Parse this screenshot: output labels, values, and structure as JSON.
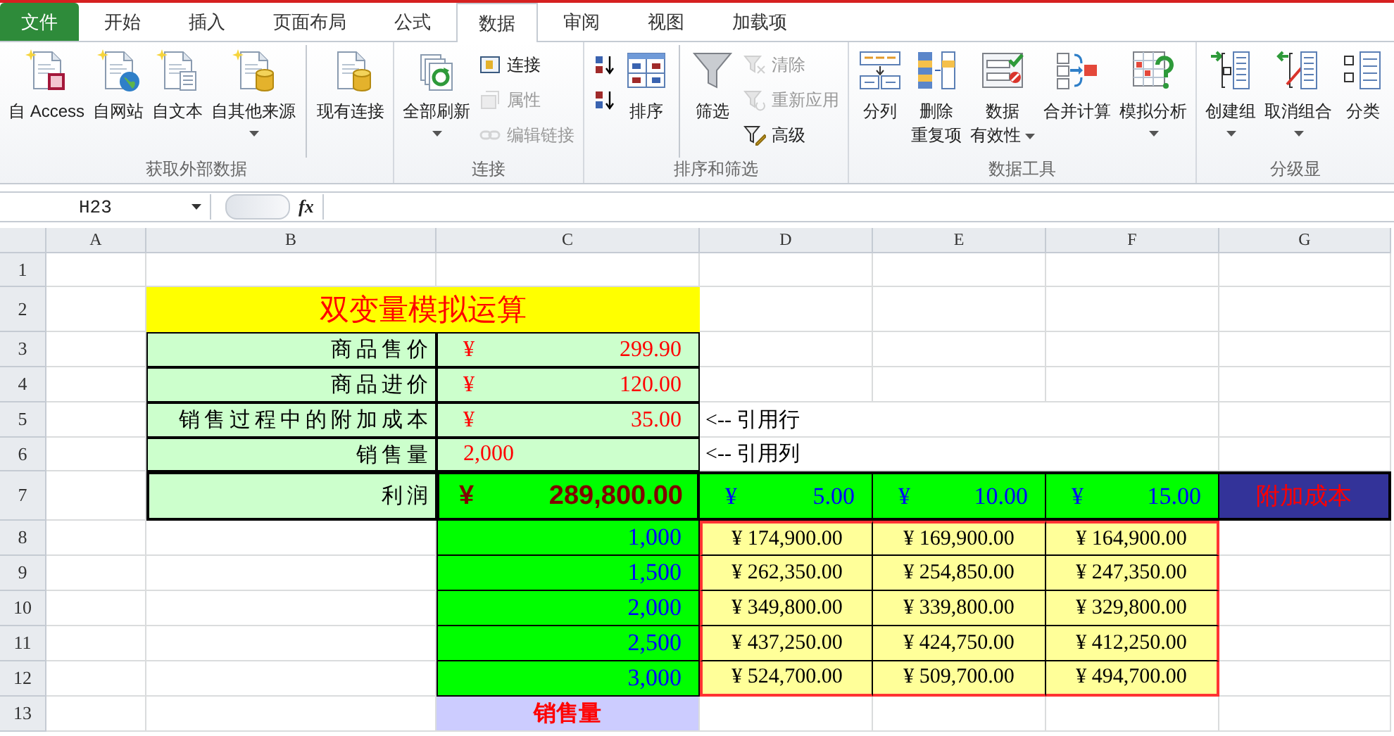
{
  "tabs": [
    {
      "label": "文件",
      "kind": "file",
      "selected": false
    },
    {
      "label": "开始",
      "kind": "tab",
      "selected": false
    },
    {
      "label": "插入",
      "kind": "tab",
      "selected": false
    },
    {
      "label": "页面布局",
      "kind": "tab",
      "selected": false
    },
    {
      "label": "公式",
      "kind": "tab",
      "selected": false
    },
    {
      "label": "数据",
      "kind": "tab",
      "selected": true
    },
    {
      "label": "审阅",
      "kind": "tab",
      "selected": false
    },
    {
      "label": "视图",
      "kind": "tab",
      "selected": false
    },
    {
      "label": "加载项",
      "kind": "tab",
      "selected": false
    }
  ],
  "ribbon": {
    "groups": [
      {
        "label": "获取外部数据",
        "items": [
          {
            "kind": "large",
            "lines": [
              "自 Access"
            ],
            "disabled": false,
            "dropdown": false
          },
          {
            "kind": "large",
            "lines": [
              "自网站"
            ],
            "disabled": false,
            "dropdown": false
          },
          {
            "kind": "large",
            "lines": [
              "自文本"
            ],
            "disabled": false,
            "dropdown": false
          },
          {
            "kind": "large",
            "lines": [
              "自其他来源"
            ],
            "disabled": false,
            "dropdown": true
          },
          {
            "kind": "large",
            "lines": [
              "现有连接"
            ],
            "disabled": false,
            "dropdown": false,
            "separator": true
          }
        ]
      },
      {
        "label": "连接",
        "items": [
          {
            "kind": "large",
            "lines": [
              "全部刷新"
            ],
            "disabled": false,
            "dropdown": true
          },
          {
            "kind": "small",
            "lines": [
              "连接"
            ],
            "disabled": false,
            "dropdown": false
          },
          {
            "kind": "small",
            "lines": [
              "属性"
            ],
            "disabled": true,
            "dropdown": false
          },
          {
            "kind": "small",
            "lines": [
              "编辑链接"
            ],
            "disabled": true,
            "dropdown": false
          }
        ]
      },
      {
        "label": "排序和筛选",
        "items": [
          {
            "kind": "small",
            "disabled": false,
            "dropdown": false
          },
          {
            "kind": "small",
            "disabled": false,
            "dropdown": false
          },
          {
            "kind": "large",
            "lines": [
              "排序"
            ],
            "disabled": false,
            "dropdown": false
          },
          {
            "kind": "large",
            "lines": [
              "筛选"
            ],
            "disabled": false,
            "dropdown": false,
            "separator": true
          },
          {
            "kind": "small",
            "lines": [
              "清除"
            ],
            "disabled": true,
            "dropdown": false
          },
          {
            "kind": "small",
            "lines": [
              "重新应用"
            ],
            "disabled": true,
            "dropdown": false
          },
          {
            "kind": "small",
            "lines": [
              "高级"
            ],
            "disabled": false,
            "dropdown": false
          }
        ]
      },
      {
        "label": "数据工具",
        "items": [
          {
            "kind": "large",
            "lines": [
              "分列"
            ],
            "disabled": false,
            "dropdown": false
          },
          {
            "kind": "large",
            "lines": [
              "删除",
              "重复项"
            ],
            "disabled": false,
            "dropdown": false
          },
          {
            "kind": "large",
            "lines": [
              "数据",
              "有效性"
            ],
            "disabled": false,
            "dropdown": true
          },
          {
            "kind": "large",
            "lines": [
              "合并计算"
            ],
            "disabled": false,
            "dropdown": false
          },
          {
            "kind": "large",
            "lines": [
              "模拟分析"
            ],
            "disabled": false,
            "dropdown": true
          }
        ]
      },
      {
        "label": "分级显",
        "items": [
          {
            "kind": "large",
            "lines": [
              "创建组"
            ],
            "disabled": false,
            "dropdown": true
          },
          {
            "kind": "large",
            "lines": [
              "取消组合"
            ],
            "disabled": false,
            "dropdown": true
          },
          {
            "kind": "large",
            "lines": [
              "分类"
            ],
            "disabled": false,
            "dropdown": false
          }
        ]
      }
    ]
  },
  "formula_bar": {
    "name_box": "H23",
    "fx": "fx"
  },
  "sheet": {
    "columns": [
      "A",
      "B",
      "C",
      "D",
      "E",
      "F",
      "G"
    ],
    "row_numbers": [
      "1",
      "2",
      "3",
      "4",
      "5",
      "6",
      "7",
      "8",
      "9",
      "10",
      "11",
      "12",
      "13"
    ],
    "title": "双变量模拟运算",
    "params": [
      {
        "label": "商品售价",
        "currency": "¥",
        "value": "299.90"
      },
      {
        "label": "商品进价",
        "currency": "¥",
        "value": "120.00"
      },
      {
        "label": "销售过程中的附加成本",
        "currency": "¥",
        "value": "35.00",
        "note": "<-- 引用行"
      },
      {
        "label": "销售量",
        "value": "2,000",
        "note": "<-- 引用列"
      }
    ],
    "profit": {
      "label": "利润",
      "currency": "¥",
      "value": "289,800.00"
    },
    "cost_values": [
      {
        "currency": "¥",
        "value": "5.00"
      },
      {
        "currency": "¥",
        "value": "10.00"
      },
      {
        "currency": "¥",
        "value": "15.00"
      }
    ],
    "cost_label": "附加成本",
    "table_rows": [
      {
        "quantity": "1,000",
        "results": [
          "¥ 174,900.00",
          "¥ 169,900.00",
          "¥ 164,900.00"
        ]
      },
      {
        "quantity": "1,500",
        "results": [
          "¥ 262,350.00",
          "¥ 254,850.00",
          "¥ 247,350.00"
        ]
      },
      {
        "quantity": "2,000",
        "results": [
          "¥ 349,800.00",
          "¥ 339,800.00",
          "¥ 329,800.00"
        ]
      },
      {
        "quantity": "2,500",
        "results": [
          "¥ 437,250.00",
          "¥ 424,750.00",
          "¥ 412,250.00"
        ]
      },
      {
        "quantity": "3,000",
        "results": [
          "¥ 524,700.00",
          "¥ 509,700.00",
          "¥ 494,700.00"
        ]
      }
    ],
    "quantity_label": "销售量"
  }
}
